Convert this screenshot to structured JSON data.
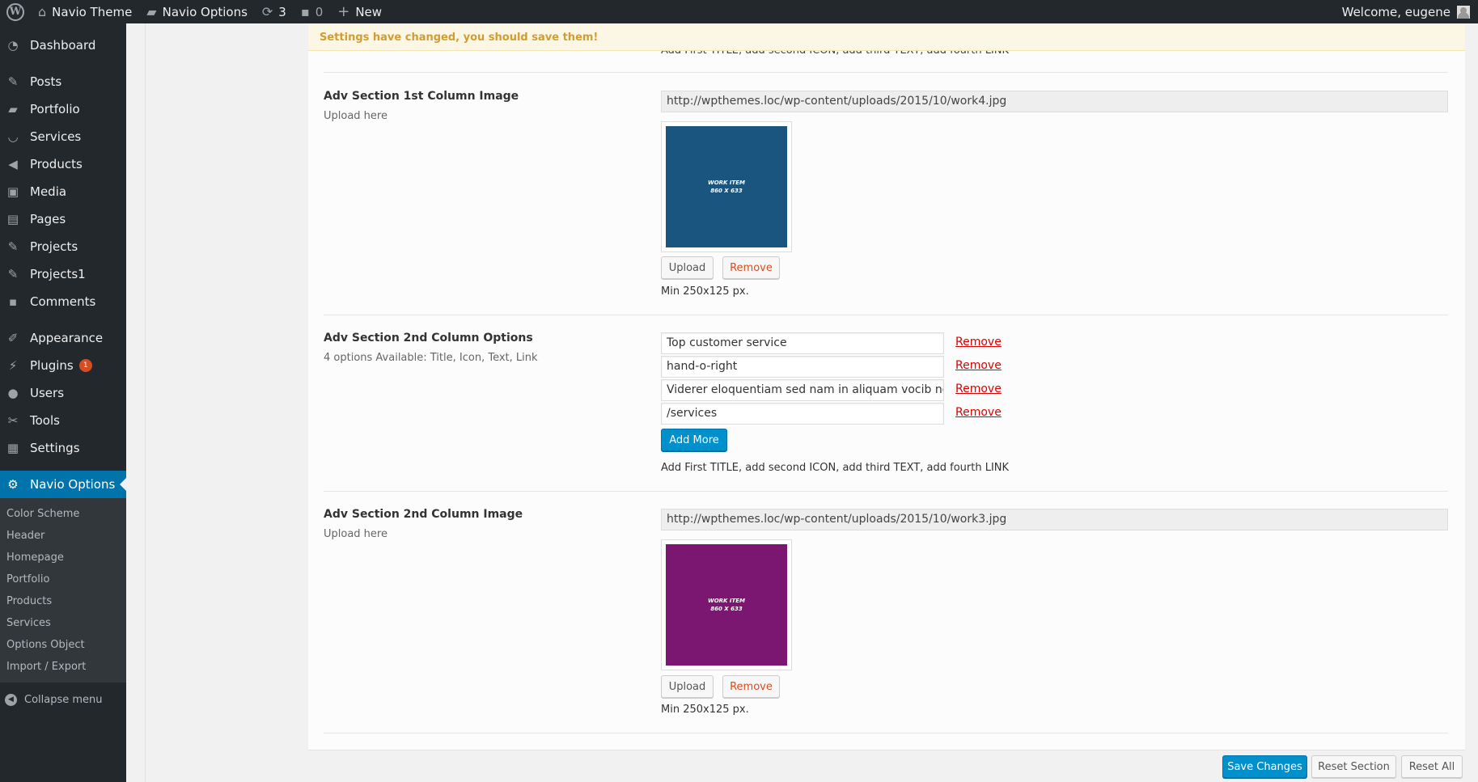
{
  "adminbar": {
    "site_name": "Navio Theme",
    "options_link": "Navio Options",
    "updates_count": "3",
    "comments_count": "0",
    "new_label": "New",
    "welcome": "Welcome, eugene"
  },
  "sidebar": {
    "items": [
      {
        "label": "Dashboard"
      },
      {
        "label": "Posts"
      },
      {
        "label": "Portfolio"
      },
      {
        "label": "Services"
      },
      {
        "label": "Products"
      },
      {
        "label": "Media"
      },
      {
        "label": "Pages"
      },
      {
        "label": "Projects"
      },
      {
        "label": "Projects1"
      },
      {
        "label": "Comments"
      },
      {
        "label": "Appearance"
      },
      {
        "label": "Plugins",
        "badge": "1"
      },
      {
        "label": "Users"
      },
      {
        "label": "Tools"
      },
      {
        "label": "Settings"
      },
      {
        "label": "Navio Options"
      }
    ],
    "submenu": [
      "Color Scheme",
      "Header",
      "Homepage",
      "Portfolio",
      "Products",
      "Services",
      "Options Object",
      "Import / Export"
    ],
    "collapse_label": "Collapse menu"
  },
  "notice": "Settings have changed, you should save them!",
  "clipped_help": "Add First TITLE, add second ICON, add third TEXT, add fourth LINK",
  "sections": {
    "image1": {
      "title": "Adv Section 1st Column Image",
      "desc": "Upload here",
      "url": "http://wpthemes.loc/wp-content/uploads/2015/10/work4.jpg",
      "thumb_line1": "WORK ITEM",
      "thumb_line2": "860 X 633",
      "thumb_color": "#1a5580",
      "upload_label": "Upload",
      "remove_label": "Remove",
      "help": "Min 250x125 px."
    },
    "options2": {
      "title": "Adv Section 2nd Column Options",
      "desc": "4 options Available: Title, Icon, Text, Link",
      "values": [
        "Top customer service",
        "hand-o-right",
        "Viderer eloquentiam sed nam in aliquam vocib no ac",
        "/services"
      ],
      "remove_label": "Remove",
      "add_more_label": "Add More",
      "help": "Add First TITLE, add second ICON, add third TEXT, add fourth LINK"
    },
    "image2": {
      "title": "Adv Section 2nd Column Image",
      "desc": "Upload here",
      "url": "http://wpthemes.loc/wp-content/uploads/2015/10/work3.jpg",
      "thumb_line1": "WORK ITEM",
      "thumb_line2": "860 X 633",
      "thumb_color": "#7b1770",
      "upload_label": "Upload",
      "remove_label": "Remove",
      "help": "Min 250x125 px."
    }
  },
  "footer": {
    "save_label": "Save Changes",
    "reset_section_label": "Reset Section",
    "reset_all_label": "Reset All"
  },
  "colors": {
    "admin_bar": "#23282d",
    "accent": "#0073aa",
    "primary_button": "#0091cd",
    "notice_text": "#d19d30",
    "remove_link": "#dd0000"
  }
}
